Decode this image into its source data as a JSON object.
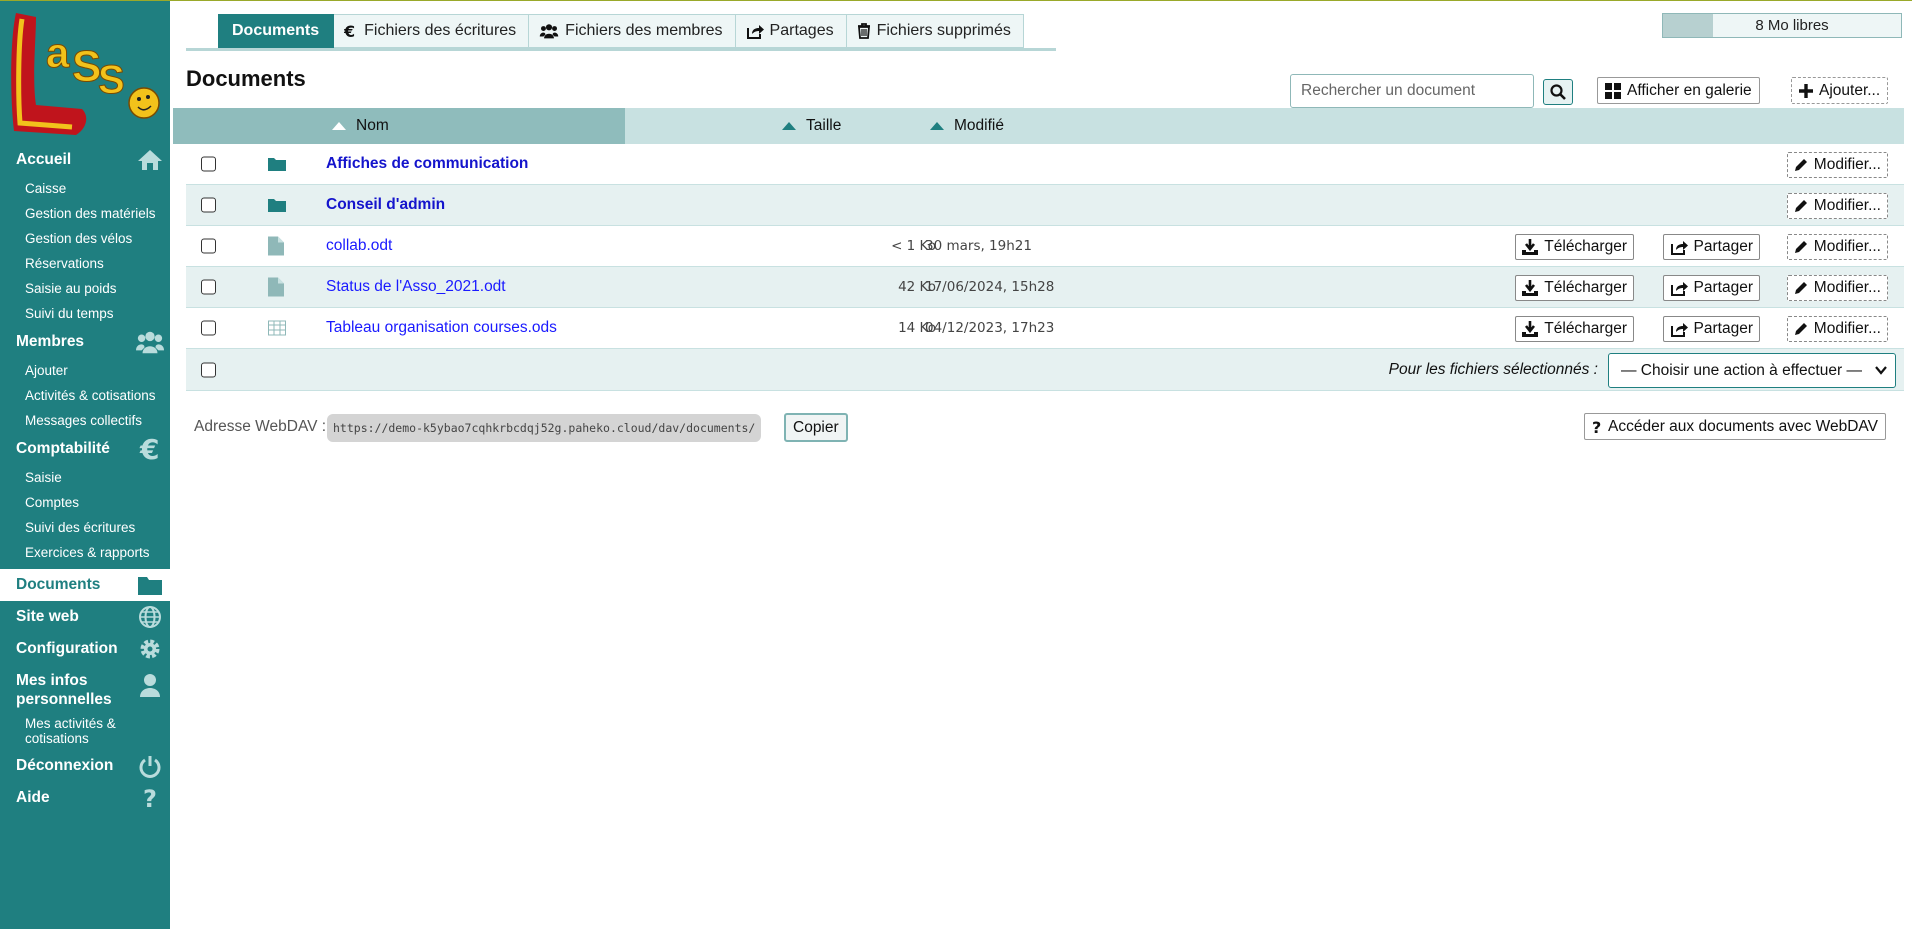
{
  "sidebar": {
    "logo_text": "Lasso",
    "menu": [
      {
        "label": "Accueil",
        "icon": "home-icon",
        "subs": [
          "Caisse",
          "Gestion des matériels",
          "Gestion des vélos",
          "Réservations",
          "Saisie au poids",
          "Suivi du temps"
        ]
      },
      {
        "label": "Membres",
        "icon": "users-icon",
        "subs": [
          "Ajouter",
          "Activités & cotisations",
          "Messages collectifs"
        ]
      },
      {
        "label": "Comptabilité",
        "icon": "euro-icon",
        "subs": [
          "Saisie",
          "Comptes",
          "Suivi des écritures",
          "Exercices & rapports"
        ]
      },
      {
        "label": "Documents",
        "icon": "folder-icon",
        "active": true,
        "subs": []
      },
      {
        "label": "Site web",
        "icon": "globe-icon",
        "subs": []
      },
      {
        "label": "Configuration",
        "icon": "gear-icon",
        "subs": []
      },
      {
        "label": "Mes infos personnelles",
        "icon": "user-icon",
        "subs": [
          "Mes activités & cotisations"
        ]
      },
      {
        "label": "Déconnexion",
        "icon": "power-icon",
        "subs": []
      },
      {
        "label": "Aide",
        "icon": "question-icon",
        "subs": []
      }
    ]
  },
  "tabs": [
    {
      "label": "Documents",
      "icon": "",
      "active": true
    },
    {
      "label": "Fichiers des écritures",
      "icon": "euro-icon"
    },
    {
      "label": "Fichiers des membres",
      "icon": "users-icon"
    },
    {
      "label": "Partages",
      "icon": "share-icon"
    },
    {
      "label": "Fichiers supprimés",
      "icon": "trash-icon"
    }
  ],
  "quota": {
    "label": "8 Mo libres",
    "used_fraction": 0.21
  },
  "page_title": "Documents",
  "search": {
    "placeholder": "Rechercher un document"
  },
  "actions": {
    "gallery": "Afficher en galerie",
    "add": "Ajouter..."
  },
  "table": {
    "columns": {
      "name": "Nom",
      "size": "Taille",
      "modified": "Modifié"
    },
    "rows": [
      {
        "type": "folder",
        "name": "Affiches de communication",
        "size": "",
        "modified": "",
        "buttons": [
          "Modifier..."
        ]
      },
      {
        "type": "folder",
        "name": "Conseil d'admin",
        "size": "",
        "modified": "",
        "buttons": [
          "Modifier..."
        ]
      },
      {
        "type": "document",
        "name": "collab.odt",
        "size": "< 1 Ko",
        "modified": "30 mars, 19h21",
        "buttons": [
          "Télécharger",
          "Partager",
          "Modifier..."
        ]
      },
      {
        "type": "document",
        "name": "Status de l'Asso_2021.odt",
        "size": "42 Ko",
        "modified": "17/06/2024, 15h28",
        "buttons": [
          "Télécharger",
          "Partager",
          "Modifier..."
        ]
      },
      {
        "type": "spreadsheet",
        "name": "Tableau organisation courses.ods",
        "size": "14 Ko",
        "modified": "04/12/2023, 17h23",
        "buttons": [
          "Télécharger",
          "Partager",
          "Modifier..."
        ]
      }
    ],
    "footer": {
      "label": "Pour les fichiers sélectionnés :",
      "select_value": "— Choisir une action à effectuer —"
    }
  },
  "webdav": {
    "label": "Adresse WebDAV :",
    "url": "https://demo-k5ybao7cqhkrbcdqj52g.paheko.cloud/dav/documents/",
    "copy": "Copier",
    "access": "Accéder aux documents avec WebDAV"
  },
  "colors": {
    "primary": "#1f7f80",
    "header": "#c8e1e1",
    "link": "#1a1aff"
  }
}
